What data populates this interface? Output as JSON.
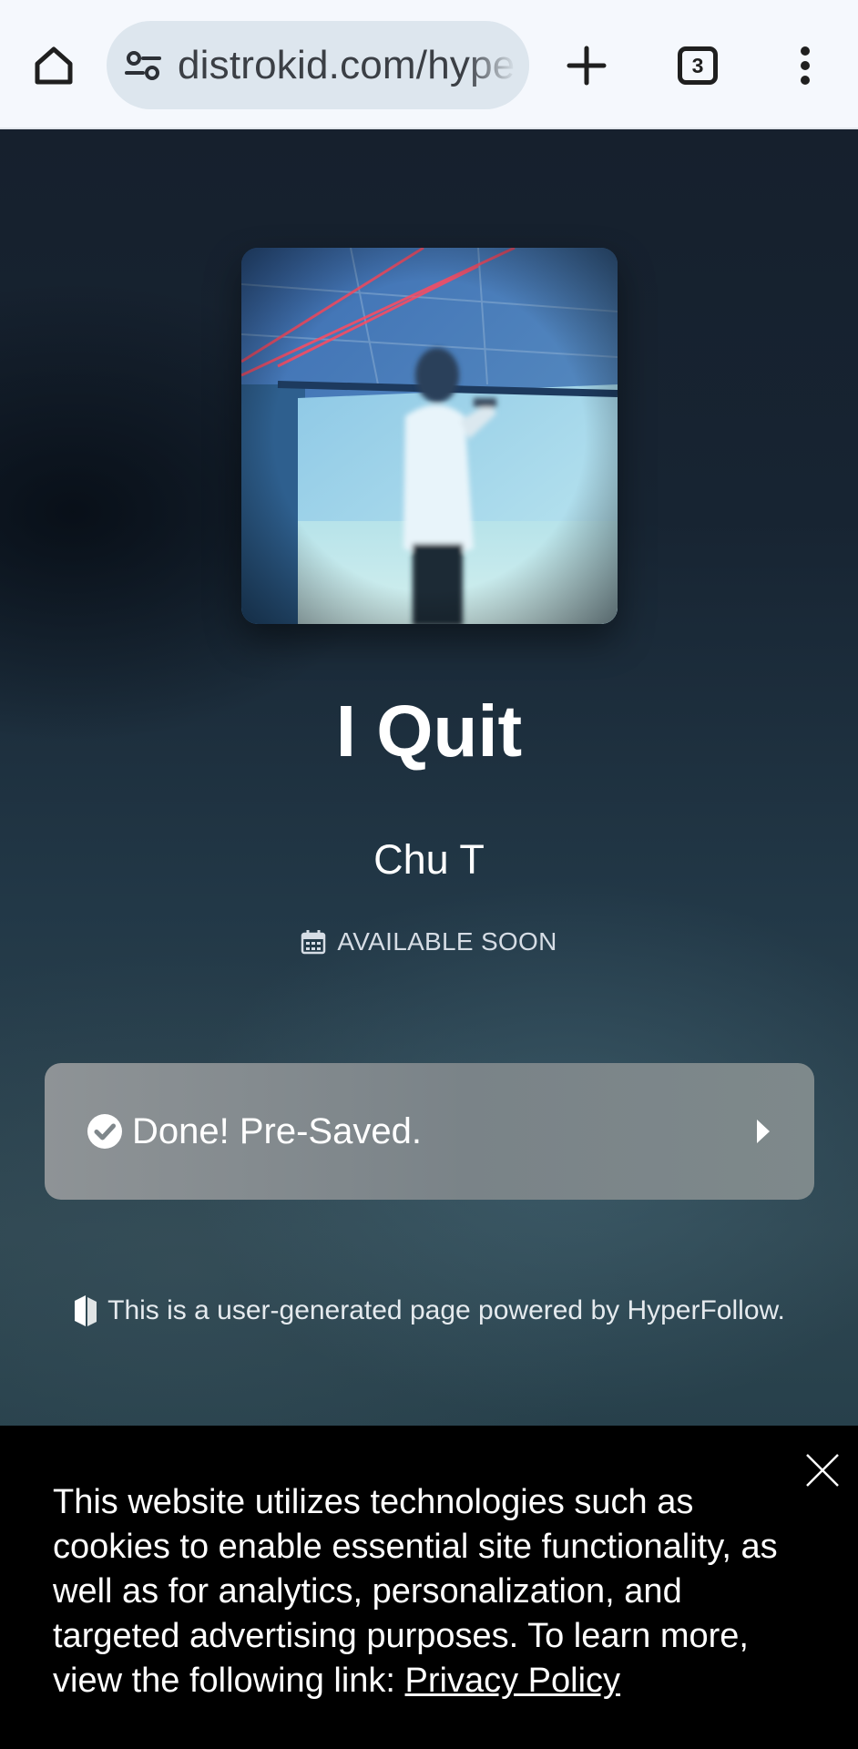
{
  "browser": {
    "url": "distrokid.com/hype",
    "tab_count": "3",
    "icons": {
      "home": "home-icon",
      "site_info": "site-info-icon",
      "new_tab": "plus-icon",
      "tabs": "tab-switcher-icon",
      "menu": "more-vert-icon"
    }
  },
  "release": {
    "title": "I Quit",
    "artist": "Chu T",
    "status": "AVAILABLE SOON",
    "status_icon": "calendar-icon"
  },
  "presave": {
    "label": "Done! Pre-Saved.",
    "icon": "check-circle-icon",
    "caret": "caret-right-icon"
  },
  "footer": {
    "note": "This is a user-generated page powered by HyperFollow.",
    "icon": "hyperfollow-logo-icon"
  },
  "cookie_banner": {
    "text": "This website utilizes technologies such as cookies to enable essential site functionality, as well as for analytics, personalization, and targeted advertising purposes. To learn more, view the following link:",
    "link_label": "Privacy Policy",
    "close_icon": "close-icon"
  },
  "colors": {
    "browser_bar": "#f5f8fd",
    "url_pill": "#dde6ee",
    "page_top": "#16202d",
    "page_bottom": "#2e4651",
    "button": "#7f878b",
    "cookie_bg": "#000000"
  }
}
